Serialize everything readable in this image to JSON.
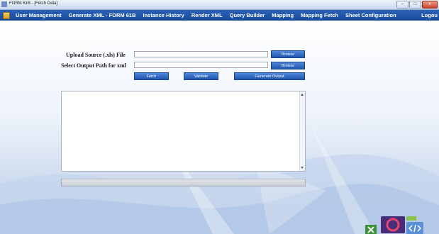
{
  "window": {
    "title": "FORM 61B - [Fetch Data]",
    "controls": {
      "minimize": "–",
      "maximize": "□",
      "close": "x"
    }
  },
  "menu": {
    "items": [
      "User Management",
      "Generate XML - FORM 61B",
      "Instance History",
      "Render XML",
      "Query Builder",
      "Mapping",
      "Mapping Fetch",
      "Sheet Configuration"
    ],
    "logout": "Logou"
  },
  "form": {
    "upload_label": "Upload Source (.xls)  File",
    "upload_value": "",
    "browse1": "Browse",
    "output_label": "Select Output Path for xml",
    "output_value": "",
    "browse2": "Browse",
    "fetch": "Fetch",
    "validate": "Validate",
    "generate": "Generate Output"
  },
  "log": {
    "text": ""
  },
  "progress": {
    "value": 0
  },
  "colors": {
    "menu_bg": "#1f55a8",
    "button": "#2f67c2",
    "background": "#dfe8f5"
  }
}
